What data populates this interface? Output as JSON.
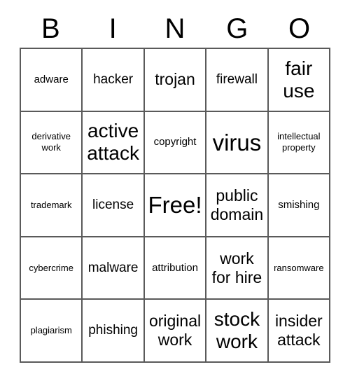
{
  "card": {
    "title": "BINGO",
    "header_letters": [
      "B",
      "I",
      "N",
      "G",
      "O"
    ],
    "grid_border_color": "#5a5a5a",
    "cell_background": "#ffffff",
    "text_color": "#000000",
    "columns": 5,
    "rows": 5,
    "free_space": "Free!",
    "cells": [
      [
        {
          "label": "adware",
          "size": "s"
        },
        {
          "label": "hacker",
          "size": "m"
        },
        {
          "label": "trojan",
          "size": "l"
        },
        {
          "label": "firewall",
          "size": "m"
        },
        {
          "label": "fair\nuse",
          "size": "xl"
        }
      ],
      [
        {
          "label": "derivative\nwork",
          "size": "xs"
        },
        {
          "label": "active\nattack",
          "size": "xl"
        },
        {
          "label": "copyright",
          "size": "s"
        },
        {
          "label": "virus",
          "size": "xxl"
        },
        {
          "label": "intellectual\nproperty",
          "size": "xs"
        }
      ],
      [
        {
          "label": "trademark",
          "size": "xs"
        },
        {
          "label": "license",
          "size": "m"
        },
        {
          "label": "Free!",
          "size": "xxl"
        },
        {
          "label": "public\ndomain",
          "size": "l"
        },
        {
          "label": "smishing",
          "size": "s"
        }
      ],
      [
        {
          "label": "cybercrime",
          "size": "xs"
        },
        {
          "label": "malware",
          "size": "m"
        },
        {
          "label": "attribution",
          "size": "s"
        },
        {
          "label": "work\nfor hire",
          "size": "l"
        },
        {
          "label": "ransomware",
          "size": "xs"
        }
      ],
      [
        {
          "label": "plagiarism",
          "size": "xs"
        },
        {
          "label": "phishing",
          "size": "m"
        },
        {
          "label": "original\nwork",
          "size": "l"
        },
        {
          "label": "stock\nwork",
          "size": "xl"
        },
        {
          "label": "insider\nattack",
          "size": "l"
        }
      ]
    ]
  }
}
